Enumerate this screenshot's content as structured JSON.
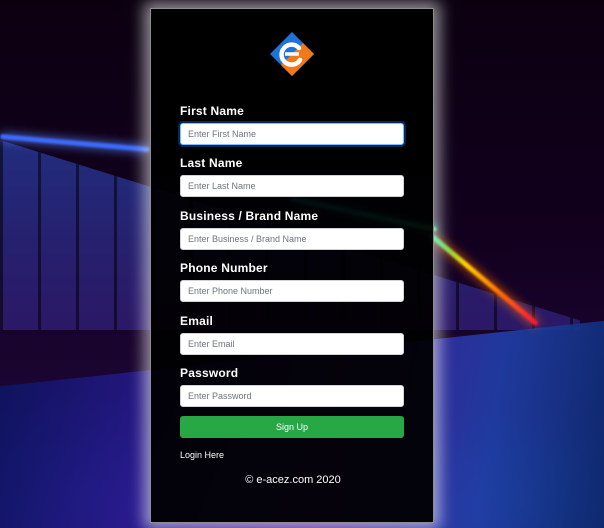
{
  "theme": {
    "accent": "#28a745",
    "focus": "#80bdff",
    "logo_blue": "#1e73d8",
    "logo_orange": "#f07a1a"
  },
  "logo": {
    "icon": "e-acez-logo"
  },
  "form": {
    "fields": [
      {
        "label": "First Name",
        "placeholder": "Enter First Name",
        "value": ""
      },
      {
        "label": "Last Name",
        "placeholder": "Enter Last Name",
        "value": ""
      },
      {
        "label": "Business / Brand Name",
        "placeholder": "Enter Business / Brand Name",
        "value": ""
      },
      {
        "label": "Phone Number",
        "placeholder": "Enter Phone Number",
        "value": ""
      },
      {
        "label": "Email",
        "placeholder": "Enter Email",
        "value": ""
      },
      {
        "label": "Password",
        "placeholder": "Enter Password",
        "value": ""
      }
    ],
    "submit_label": "Sign Up",
    "login_link": "Login Here"
  },
  "footer": {
    "copyright": "© e-acez.com 2020"
  }
}
